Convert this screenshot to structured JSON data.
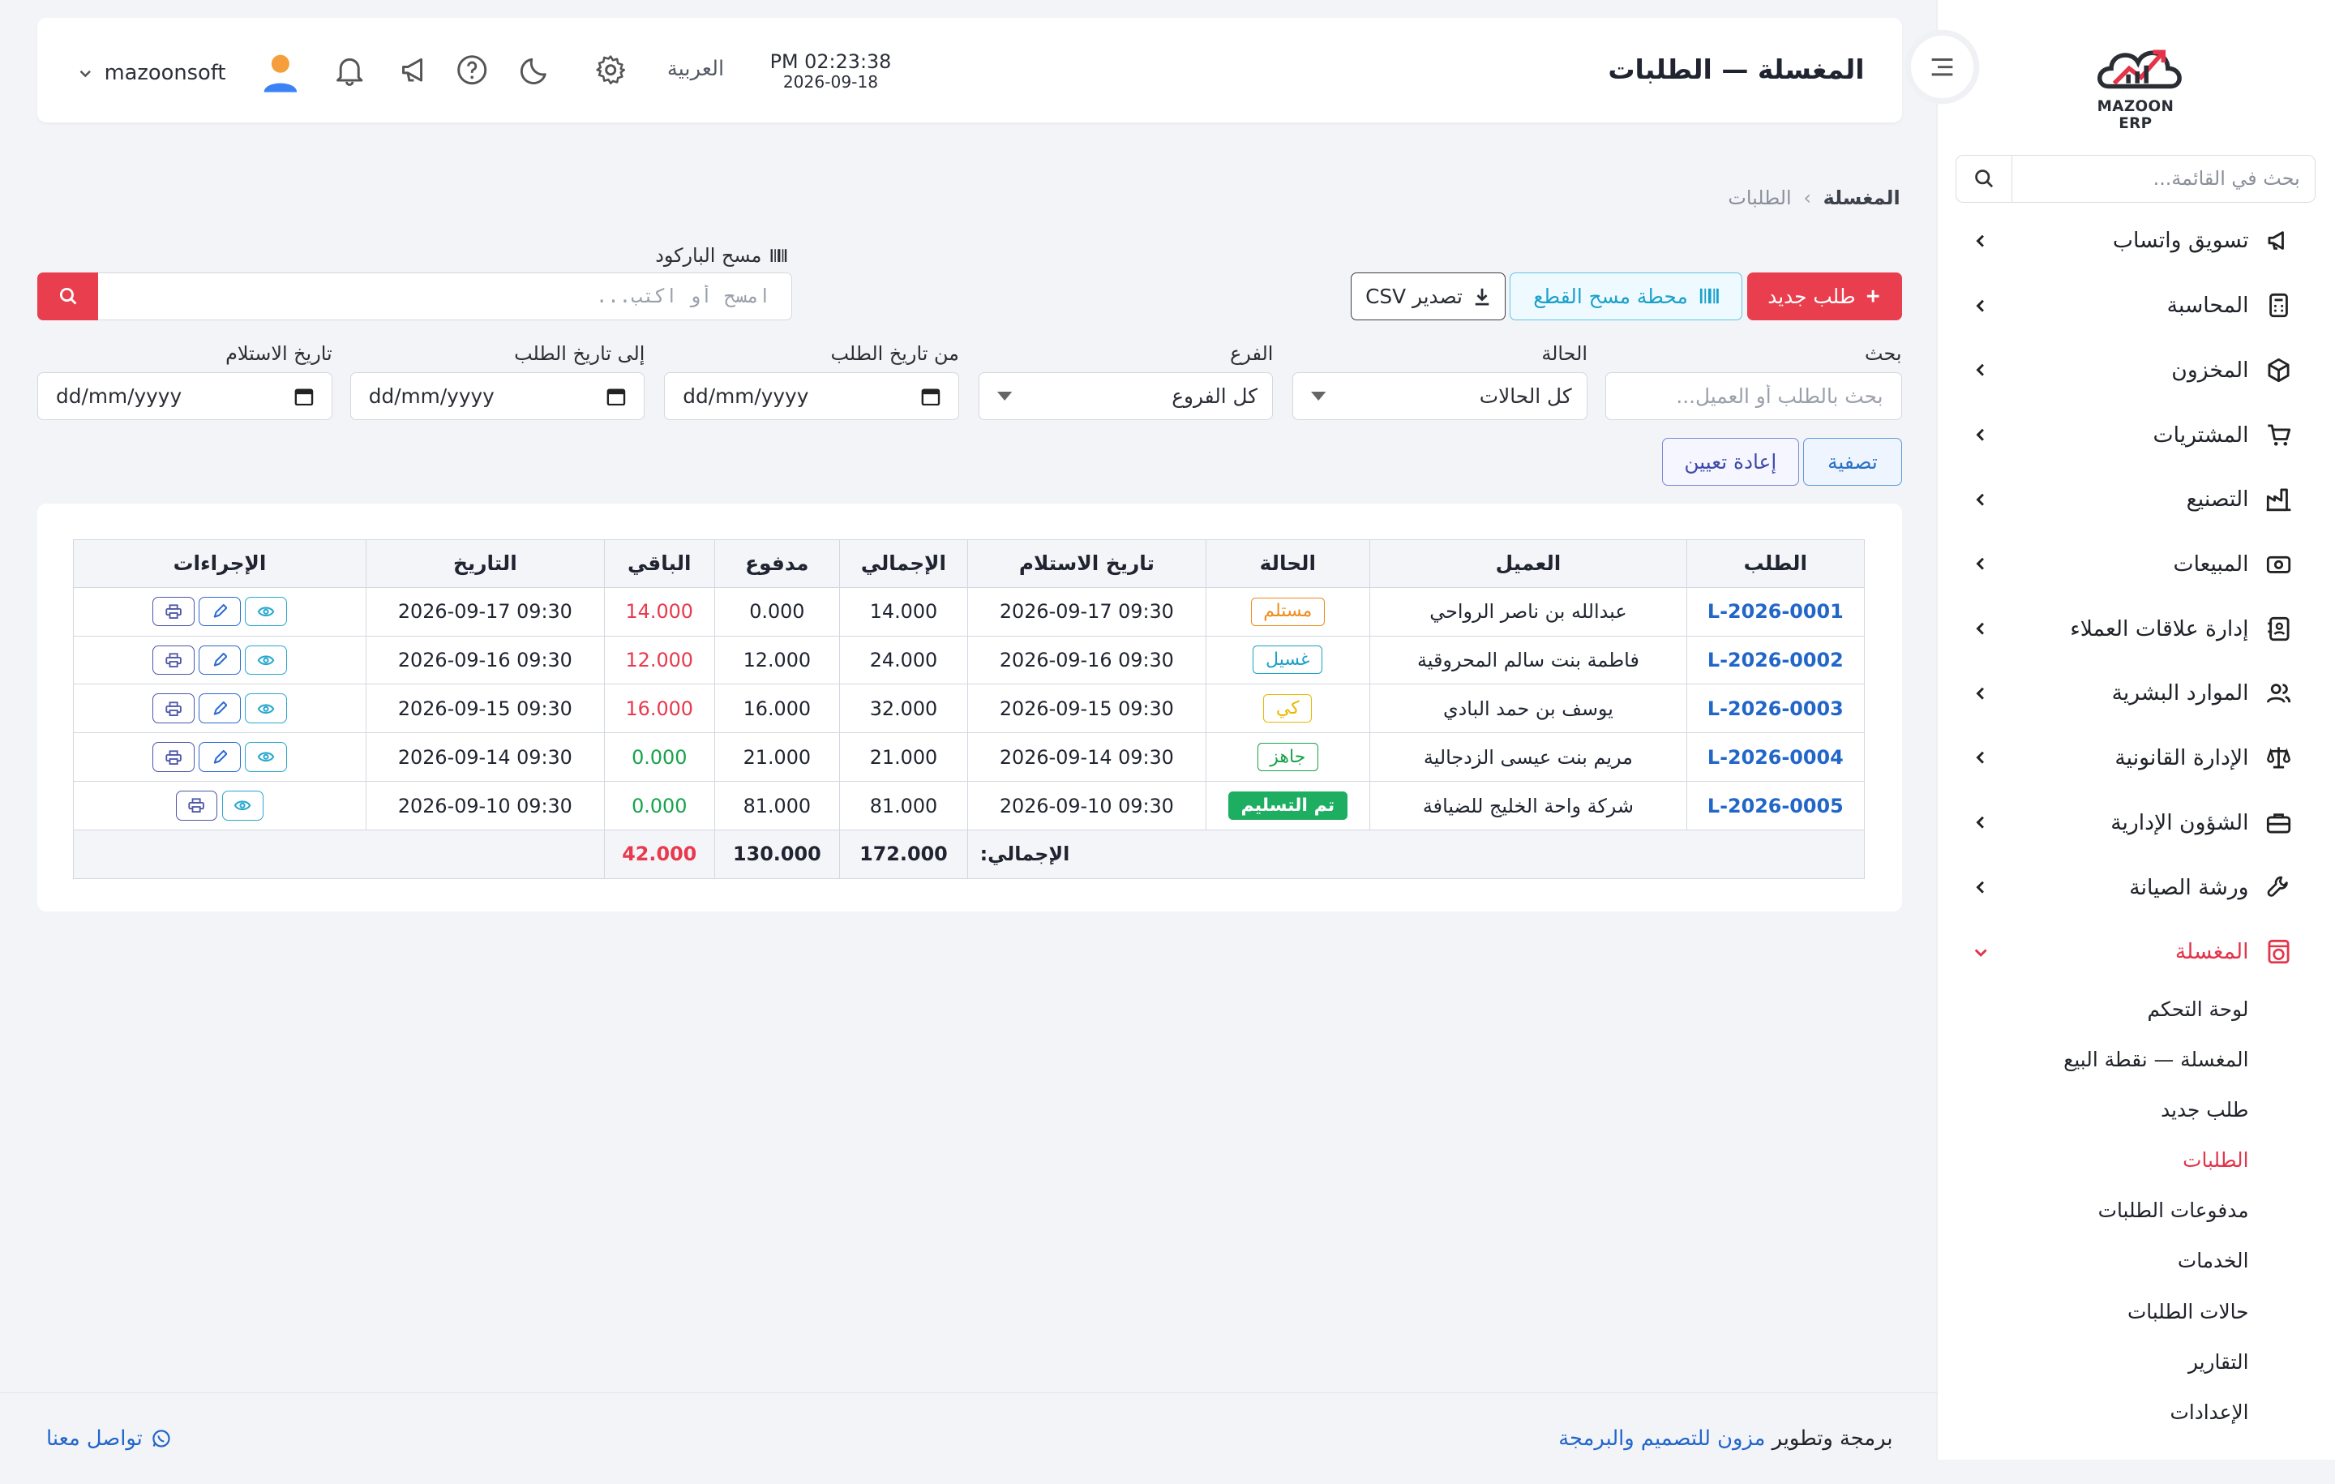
{
  "app": {
    "logo_text": "MAZOON ERP",
    "page_title": "المغسلة — الطلبات"
  },
  "topbar": {
    "username": "mazoonsoft",
    "language": "العربية",
    "time": "PM 02:23:38",
    "date": "2026-09-18",
    "icons": [
      "bell-icon",
      "megaphone-icon",
      "help-icon",
      "moon-icon",
      "gear-icon",
      "avatar"
    ]
  },
  "sidebar": {
    "search_placeholder": "بحث في القائمة...",
    "items": [
      {
        "label": "تسويق واتساب",
        "icon": "megaphone-icon"
      },
      {
        "label": "المحاسبة",
        "icon": "calculator-icon"
      },
      {
        "label": "المخزون",
        "icon": "box-icon"
      },
      {
        "label": "المشتريات",
        "icon": "cart-icon"
      },
      {
        "label": "التصنيع",
        "icon": "factory-icon"
      },
      {
        "label": "المبيعات",
        "icon": "cash-icon"
      },
      {
        "label": "إدارة علاقات العملاء",
        "icon": "contact-card-icon"
      },
      {
        "label": "الموارد البشرية",
        "icon": "users-icon"
      },
      {
        "label": "الإدارة القانونية",
        "icon": "scales-icon"
      },
      {
        "label": "الشؤون الإدارية",
        "icon": "briefcase-icon"
      },
      {
        "label": "ورشة الصيانة",
        "icon": "wrench-icon"
      }
    ],
    "active_section": {
      "label": "المغسلة",
      "icon": "laundry-icon"
    },
    "sub_items": [
      {
        "label": "لوحة التحكم",
        "active": false
      },
      {
        "label": "المغسلة — نقطة البيع",
        "active": false
      },
      {
        "label": "طلب جديد",
        "active": false
      },
      {
        "label": "الطلبات",
        "active": true
      },
      {
        "label": "مدفوعات الطلبات",
        "active": false
      },
      {
        "label": "الخدمات",
        "active": false
      },
      {
        "label": "حالات الطلبات",
        "active": false
      },
      {
        "label": "التقارير",
        "active": false
      },
      {
        "label": "الإعدادات",
        "active": false
      }
    ]
  },
  "breadcrumb": {
    "root": "المغسلة",
    "separator": "›",
    "current": "الطلبات"
  },
  "actions": {
    "new_order": "طلب جديد",
    "scan_station": "محطة مسح القطع",
    "export_csv": "تصدير CSV"
  },
  "barcode": {
    "label": "مسح الباركود",
    "placeholder": "امسح أو اكتب..."
  },
  "filters": {
    "search_label": "بحث",
    "search_placeholder": "بحث بالطلب أو العميل...",
    "status_label": "الحالة",
    "status_value": "كل الحالات",
    "branch_label": "الفرع",
    "branch_value": "كل الفروع",
    "from_date_label": "من تاريخ الطلب",
    "to_date_label": "إلى تاريخ الطلب",
    "pickup_date_label": "تاريخ الاستلام",
    "date_placeholder": "dd/mm/yyyy",
    "filter_button": "تصفية",
    "reset_button": "إعادة تعيين"
  },
  "table": {
    "headers": [
      "الطلب",
      "العميل",
      "الحالة",
      "تاريخ الاستلام",
      "الإجمالي",
      "مدفوع",
      "الباقي",
      "التاريخ",
      "الإجراءات"
    ],
    "rows": [
      {
        "order": "L-2026-0001",
        "customer": "عبدالله بن ناصر الرواحي",
        "status": "مستلم",
        "status_class": "b-received",
        "pickup": "2026-09-17 09:30",
        "total": "14.000",
        "paid": "0.000",
        "due": "14.000",
        "due_color": "red",
        "date": "2026-09-17 09:30",
        "actions": [
          "view",
          "edit",
          "print"
        ]
      },
      {
        "order": "L-2026-0002",
        "customer": "فاطمة بنت سالم المحروقية",
        "status": "غسيل",
        "status_class": "b-washing",
        "pickup": "2026-09-16 09:30",
        "total": "24.000",
        "paid": "12.000",
        "due": "12.000",
        "due_color": "red",
        "date": "2026-09-16 09:30",
        "actions": [
          "view",
          "edit",
          "print"
        ]
      },
      {
        "order": "L-2026-0003",
        "customer": "يوسف بن حمد البادي",
        "status": "كي",
        "status_class": "b-ironing",
        "pickup": "2026-09-15 09:30",
        "total": "32.000",
        "paid": "16.000",
        "due": "16.000",
        "due_color": "red",
        "date": "2026-09-15 09:30",
        "actions": [
          "view",
          "edit",
          "print"
        ]
      },
      {
        "order": "L-2026-0004",
        "customer": "مريم بنت عيسى الزدجالية",
        "status": "جاهز",
        "status_class": "b-ready",
        "pickup": "2026-09-14 09:30",
        "total": "21.000",
        "paid": "21.000",
        "due": "0.000",
        "due_color": "green",
        "date": "2026-09-14 09:30",
        "actions": [
          "view",
          "edit",
          "print"
        ]
      },
      {
        "order": "L-2026-0005",
        "customer": "شركة واحة الخليج للضيافة",
        "status": "تم التسليم",
        "status_class": "b-delivered",
        "pickup": "2026-09-10 09:30",
        "total": "81.000",
        "paid": "81.000",
        "due": "0.000",
        "due_color": "green",
        "date": "2026-09-10 09:30",
        "actions": [
          "view",
          "print"
        ]
      }
    ],
    "totals": {
      "label": "الإجمالي:",
      "total": "172.000",
      "paid": "130.000",
      "due": "42.000"
    }
  },
  "footer": {
    "credit_prefix": "برمجة وتطوير",
    "credit_link": "مزون للتصميم والبرمجة",
    "contact": "تواصل معنا"
  },
  "colors": {
    "accent_red": "#e83e4e",
    "link_blue": "#2266c9",
    "due_red": "#e8394d",
    "due_green": "#17a34a"
  }
}
